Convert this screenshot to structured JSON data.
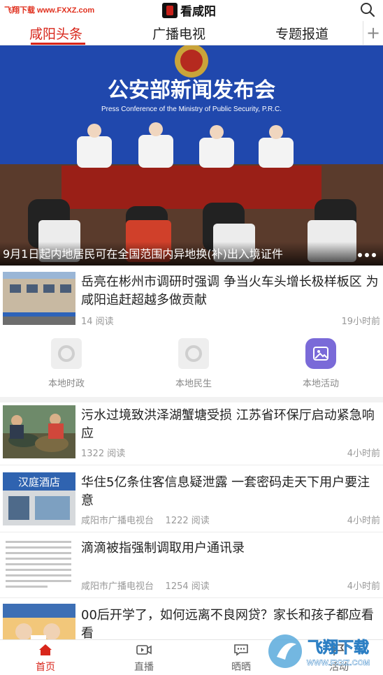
{
  "watermark_top": "飞翔下载 www.FXXZ.com",
  "app": {
    "title": "看咸阳"
  },
  "tabs": [
    {
      "label": "咸阳头条",
      "active": true
    },
    {
      "label": "广播电视",
      "active": false
    },
    {
      "label": "专题报道",
      "active": false
    }
  ],
  "tabs_more": "+",
  "hero": {
    "banner_title": "公安部新闻发布会",
    "banner_subtitle": "Press Conference of the Ministry of Public Security, P.R.C.",
    "caption": "9月1日起内地居民可在全国范围内异地换(补)出入境证件"
  },
  "news": [
    {
      "title": "岳亮在彬州市调研时强调 争当火车头增长极样板区 为咸阳追赶超越多做贡献",
      "source": "",
      "reads": "14 阅读",
      "time": "19小时前"
    },
    {
      "title": "污水过境致洪泽湖蟹塘受损 江苏省环保厅启动紧急响应",
      "source": "",
      "reads": "1322 阅读",
      "time": "4小时前"
    },
    {
      "title": "华住5亿条住客信息疑泄露 一套密码走天下用户要注意",
      "source": "咸阳市广播电视台",
      "reads": "1222 阅读",
      "time": "4小时前",
      "thumb_text": "汉庭酒店"
    },
    {
      "title": "滴滴被指强制调取用户通讯录",
      "source": "咸阳市广播电视台",
      "reads": "1254 阅读",
      "time": "4小时前"
    },
    {
      "title": "00后开学了，如何远离不良网贷？家长和孩子都应看看",
      "source": "",
      "reads": "",
      "time": ""
    }
  ],
  "quick_links": [
    {
      "label": "本地时政",
      "icon": "loading-icon"
    },
    {
      "label": "本地民生",
      "icon": "loading-icon"
    },
    {
      "label": "本地活动",
      "icon": "image-icon"
    }
  ],
  "bottom_nav": [
    {
      "label": "首页",
      "icon": "home-icon",
      "active": true
    },
    {
      "label": "直播",
      "icon": "video-icon",
      "active": false
    },
    {
      "label": "晒晒",
      "icon": "chat-icon",
      "active": false
    },
    {
      "label": "活动",
      "icon": "flag-icon",
      "active": false
    }
  ],
  "watermark_bottom": {
    "brand": "飞翔下载",
    "url": "WWW.FXXZ.COM"
  },
  "colors": {
    "accent": "#d8261b",
    "quick_purple": "#7a6ad8"
  }
}
